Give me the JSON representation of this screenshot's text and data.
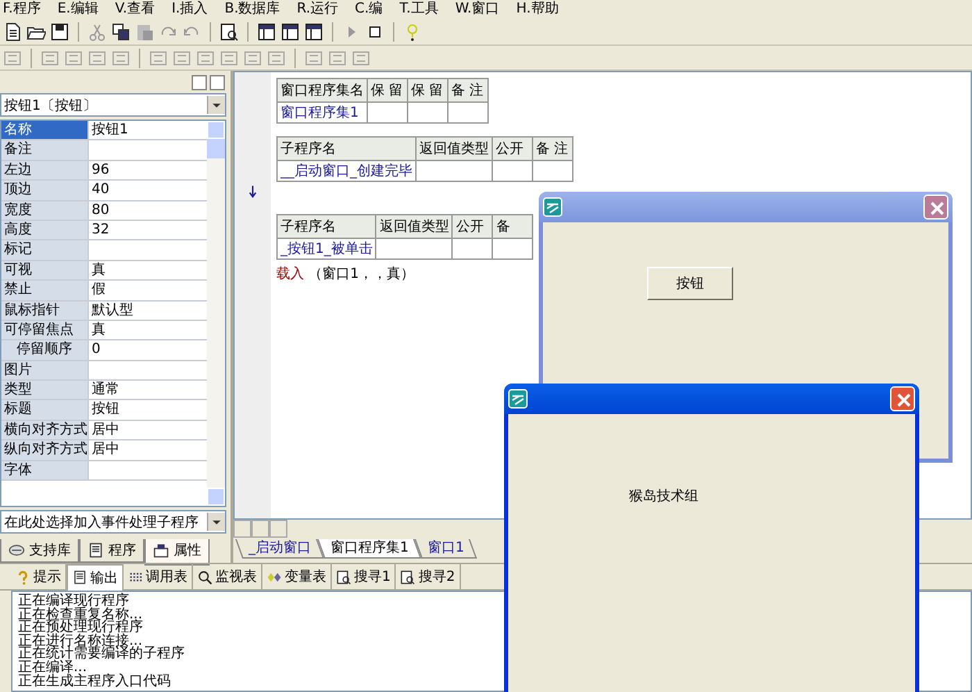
{
  "menu": [
    "F.程序",
    "E.编辑",
    "V.查看",
    "I.插入",
    "B.数据库",
    "R.运行",
    "C.编",
    "T.工具",
    "W.窗口",
    "H.帮助"
  ],
  "properties_panel": {
    "object_selector": "按钮1〔按钮〕",
    "rows": [
      {
        "name": "名称",
        "value": "按钮1",
        "selected": true
      },
      {
        "name": "备注",
        "selected": false
      },
      {
        "name": "左边",
        "value": "96",
        "selected": false
      },
      {
        "name": "顶边",
        "value": "40",
        "selected": false
      },
      {
        "name": "宽度",
        "value": "80",
        "selected": false
      },
      {
        "name": "高度",
        "value": "32",
        "selected": false
      },
      {
        "name": "标记",
        "selected": false
      },
      {
        "name": "可视",
        "value": "真",
        "selected": false
      },
      {
        "name": "禁止",
        "value": "假",
        "selected": false
      },
      {
        "name": "鼠标指针",
        "value": "默认型",
        "selected": false
      },
      {
        "name": "可停留焦点",
        "value": "真",
        "selected": false,
        "children": [
          {
            "name": "停留顺序",
            "value": "0",
            "selected": false
          }
        ]
      },
      {
        "name": "图片",
        "selected": false
      },
      {
        "name": "类型",
        "value": "通常",
        "selected": false
      },
      {
        "name": "标题",
        "value": "按钮",
        "selected": false
      },
      {
        "name": "横向对齐方式",
        "value": "居中",
        "selected": false
      },
      {
        "name": "纵向对齐方式",
        "value": "居中",
        "selected": false
      },
      {
        "name": "字体",
        "selected": false
      }
    ],
    "event_selector": "在此处选择加入事件处理子程序",
    "tabs": [
      {
        "label": "支持库",
        "selected": false
      },
      {
        "label": "程序",
        "selected": false
      },
      {
        "label": "属性",
        "selected": true
      }
    ]
  },
  "code": {
    "tables": [
      {
        "columns": [
          "窗口程序集名",
          "保 留",
          "保 留",
          "备 注"
        ],
        "name": "窗口程序集1"
      },
      {
        "columns": [
          "子程序名",
          "返回值类型",
          "公开",
          "备 注"
        ],
        "name": "__启动窗口_创建完毕"
      },
      {
        "columns": [
          "子程序名",
          "返回值类型",
          "公开",
          "备"
        ],
        "name": "_按钮1_被单击",
        "statement": {
          "keyword": "载入",
          "args": "（窗口1，，真）"
        }
      }
    ],
    "tabs": [
      {
        "label": "_启动窗口",
        "selected": false
      },
      {
        "label": "窗口程序集1",
        "selected": true
      },
      {
        "label": "窗口1",
        "selected": false
      }
    ]
  },
  "output_tabs": [
    {
      "label": "提示",
      "selected": false
    },
    {
      "label": "输出",
      "selected": true
    },
    {
      "label": "调用表",
      "selected": false
    },
    {
      "label": "监视表",
      "selected": false
    },
    {
      "label": "变量表",
      "selected": false
    },
    {
      "label": "搜寻1",
      "selected": false
    },
    {
      "label": "搜寻2",
      "selected": false
    }
  ],
  "output_lines": [
    "正在编译现行程序",
    "正在检查重复名称...",
    "正在预处理现行程序",
    "正在进行名称连接...",
    "正在统计需要编译的子程序",
    "正在编译...",
    "正在生成主程序入口代码"
  ],
  "windows": [
    {
      "kind": "button_form",
      "active": false,
      "button": "按钮"
    },
    {
      "kind": "label_form",
      "active": true,
      "label": "猴岛技术组"
    }
  ]
}
